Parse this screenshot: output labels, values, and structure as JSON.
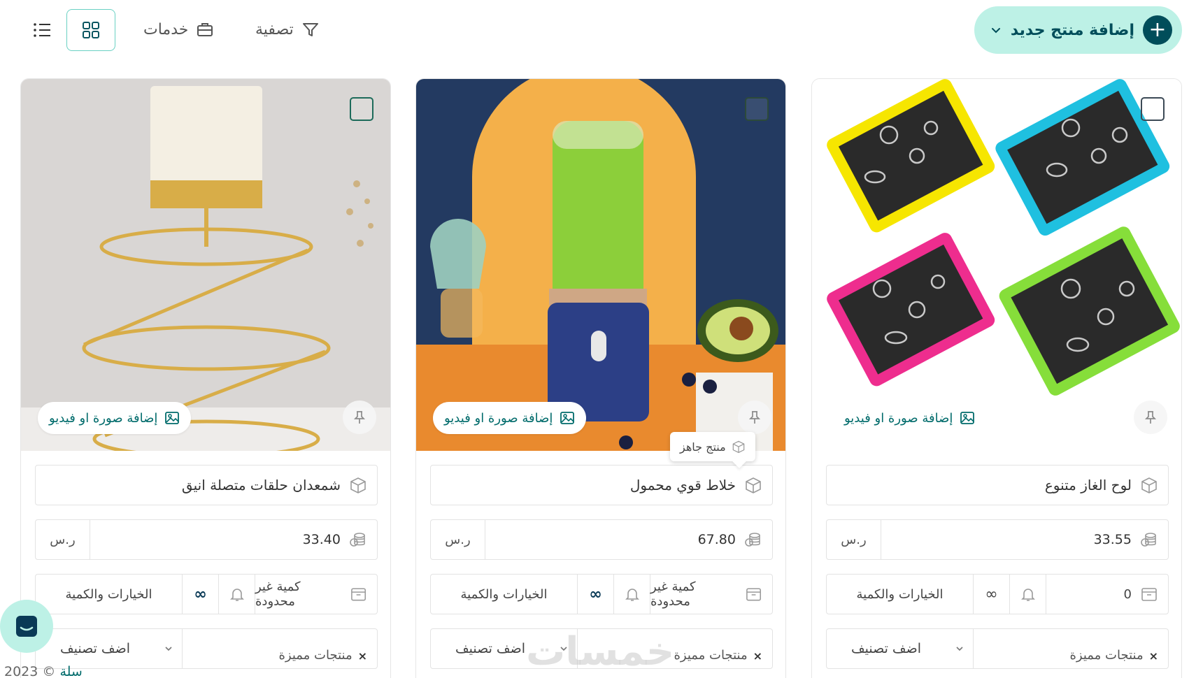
{
  "toolbar": {
    "add_product_label": "إضافة منتج جديد",
    "filter_label": "تصفية",
    "services_label": "خدمات"
  },
  "products": [
    {
      "name": "لوح الغاز متنوع",
      "price": "33.55",
      "currency": "ر.س",
      "quantity": "0",
      "options_label": "الخيارات والكمية",
      "add_category": "اضف تصنيف",
      "category_tag": "منتجات مميزة",
      "media_label": "إضافة صورة او فيديو"
    },
    {
      "name": "خلاط قوي محمول",
      "price": "67.80",
      "currency": "ر.س",
      "quantity": "كمية غير محدودة",
      "options_label": "الخيارات والكمية",
      "add_category": "اضف تصنيف",
      "category_tag": "منتجات مميزة",
      "media_label": "إضافة صورة او فيديو",
      "tooltip": "منتج جاهز"
    },
    {
      "name": "شمعدان حلقات متصلة انيق",
      "price": "33.40",
      "currency": "ر.س",
      "quantity": "كمية غير محدودة",
      "options_label": "الخيارات والكمية",
      "add_category": "اضف تصنيف",
      "category_tag": "منتجات مميزة",
      "media_label": "إضافة صورة او فيديو"
    }
  ],
  "footer": {
    "brand": "سلة",
    "copyright": "© 2023"
  },
  "watermark": "خمسات",
  "colors": {
    "accent": "#bdf1e6",
    "accent_dark": "#004d5a",
    "teal_text": "#006b6b",
    "border": "#e3e3e3"
  },
  "icons": [
    "plus-icon",
    "chevron-down-icon",
    "filter-icon",
    "briefcase-icon",
    "grid-view-icon",
    "list-view-icon",
    "pin-icon",
    "image-icon",
    "box-icon",
    "coins-icon",
    "bell-icon",
    "infinity-icon",
    "chat-icon"
  ]
}
